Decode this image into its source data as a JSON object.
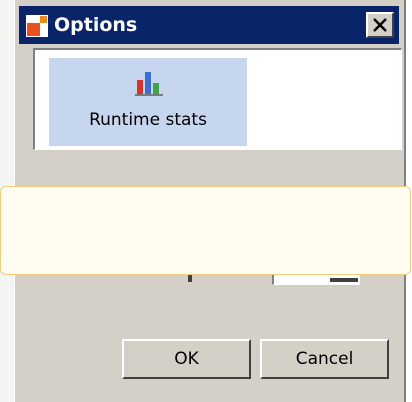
{
  "window": {
    "title": "Options",
    "app_icon": "options-app-icon",
    "close_icon": "close-icon"
  },
  "categories": {
    "items": [
      {
        "label": "Runtime stats",
        "icon": "bar-chart-icon",
        "selected": true
      }
    ]
  },
  "buttons": {
    "ok_label": "OK",
    "cancel_label": "Cancel"
  },
  "colors": {
    "titlebar": "#0a246a",
    "dialog_face": "#d4d0c8",
    "selection": "#c6d6ee",
    "popup_background": "#fffcf2",
    "popup_border": "#f2cd7d"
  }
}
